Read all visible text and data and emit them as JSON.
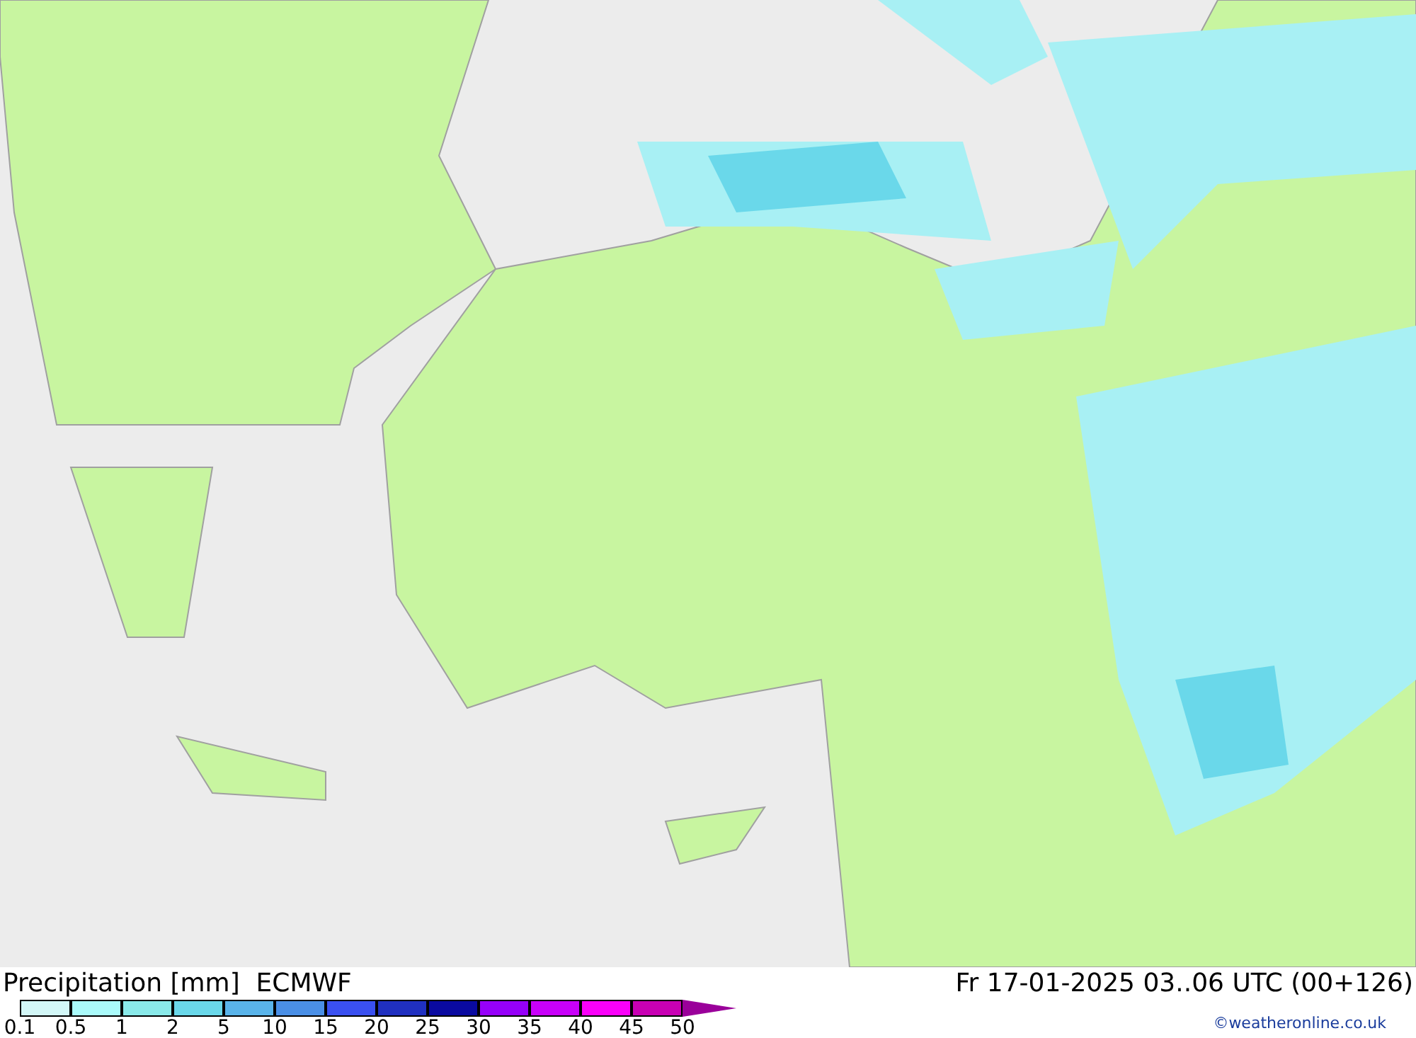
{
  "title": "Precipitation [mm]  ECMWF",
  "valid_time": "Fr 17-01-2025 03..06 UTC (00+126)",
  "legend": [
    {
      "label": "0.1",
      "color": "#d3f7f7"
    },
    {
      "label": "0.5",
      "color": "#aafafa"
    },
    {
      "label": "1",
      "color": "#8aeaea"
    },
    {
      "label": "2",
      "color": "#6ad8ea"
    },
    {
      "label": "5",
      "color": "#5ab4ea"
    },
    {
      "label": "10",
      "color": "#4a8fe6"
    },
    {
      "label": "15",
      "color": "#3a50f0"
    },
    {
      "label": "20",
      "color": "#2030c0"
    },
    {
      "label": "25",
      "color": "#0a0aa0"
    },
    {
      "label": "30",
      "color": "#9600fa"
    },
    {
      "label": "35",
      "color": "#c800fa"
    },
    {
      "label": "40",
      "color": "#fa00fa"
    },
    {
      "label": "45",
      "color": "#c800b4"
    },
    {
      "label": "50",
      "color": "#9a009a"
    }
  ],
  "credit": "©weatheronline.co.uk"
}
